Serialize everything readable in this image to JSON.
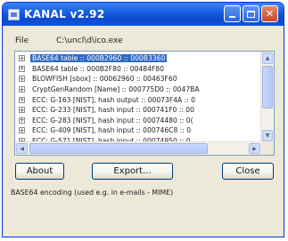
{
  "window": {
    "title": "KANAL v2.92"
  },
  "file": {
    "label": "File",
    "value": "C:\\uncl\\d\\ico.exe"
  },
  "results": [
    {
      "text": "BASE64 table :: 000B2960 :: 000B3360",
      "selected": true
    },
    {
      "text": "BASE64 table :: 000B2F80 :: 00484F80",
      "selected": false
    },
    {
      "text": "BLOWFISH [sbox] :: 00062960 :: 00463F60",
      "selected": false
    },
    {
      "text": "CryptGenRandom [Name] :: 000775D0 :: 0047BA",
      "selected": false
    },
    {
      "text": "ECC: G-163 [NIST], hash output :: 00073F4A :: 0",
      "selected": false
    },
    {
      "text": "ECC: G-233 [NIST], hash input :: 000741F0 :: 00",
      "selected": false
    },
    {
      "text": "ECC: G-283 [NIST], hash input :: 00074480 :: 0(",
      "selected": false
    },
    {
      "text": "ECC: G-409 [NIST], hash input :: 000746C8 :: 0",
      "selected": false
    },
    {
      "text": "ECC: G-571 [NIST], hash input :: 00074950 :: 0",
      "selected": false
    }
  ],
  "buttons": {
    "about": "About",
    "export": "Export...",
    "close": "Close"
  },
  "status": {
    "text": "BASE64 encoding (used e.g. in e-mails - MIME)"
  }
}
